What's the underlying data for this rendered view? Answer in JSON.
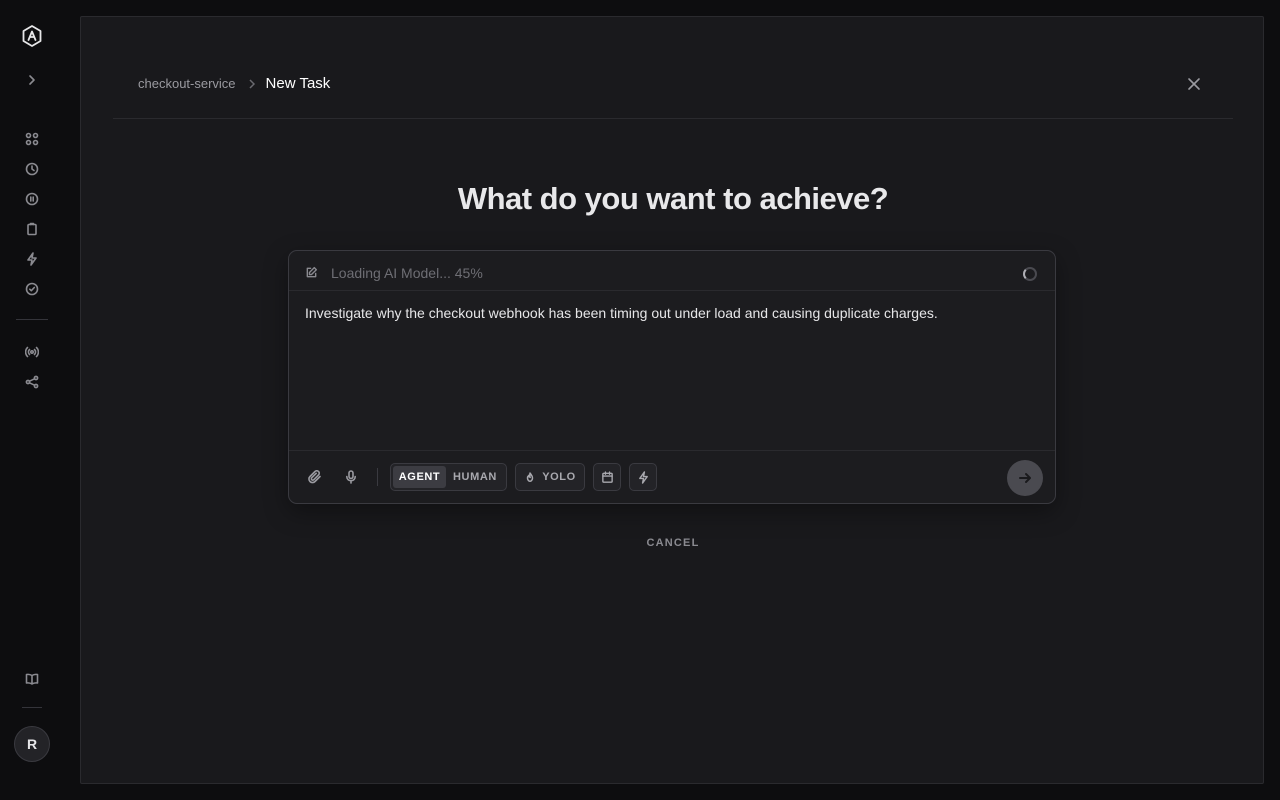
{
  "breadcrumb": {
    "parent": "checkout-service",
    "current": "New Task"
  },
  "heading": "What do you want to achieve?",
  "composer": {
    "status": "Loading AI Model... 45%",
    "status_progress_percent": 45,
    "task_text": "Investigate why the checkout webhook has been timing out under load and causing duplicate charges.",
    "mode_agent": "AGENT",
    "mode_human": "HUMAN",
    "selected_mode": "AGENT",
    "yolo_label": "YOLO"
  },
  "cancel_label": "CANCEL",
  "user": {
    "avatar_initial": "R"
  },
  "sidebar_icons": [
    "logo-icon",
    "expand-icon",
    "dashboard-icon",
    "history-icon",
    "paused-icon",
    "clipboard-icon",
    "bolt-icon",
    "check-circle-icon",
    "broadcast-icon",
    "share-icon",
    "docs-icon"
  ],
  "colors": {
    "background": "#0d0d0f",
    "panel": "#19191c",
    "accent_text": "#e6e6e8"
  }
}
